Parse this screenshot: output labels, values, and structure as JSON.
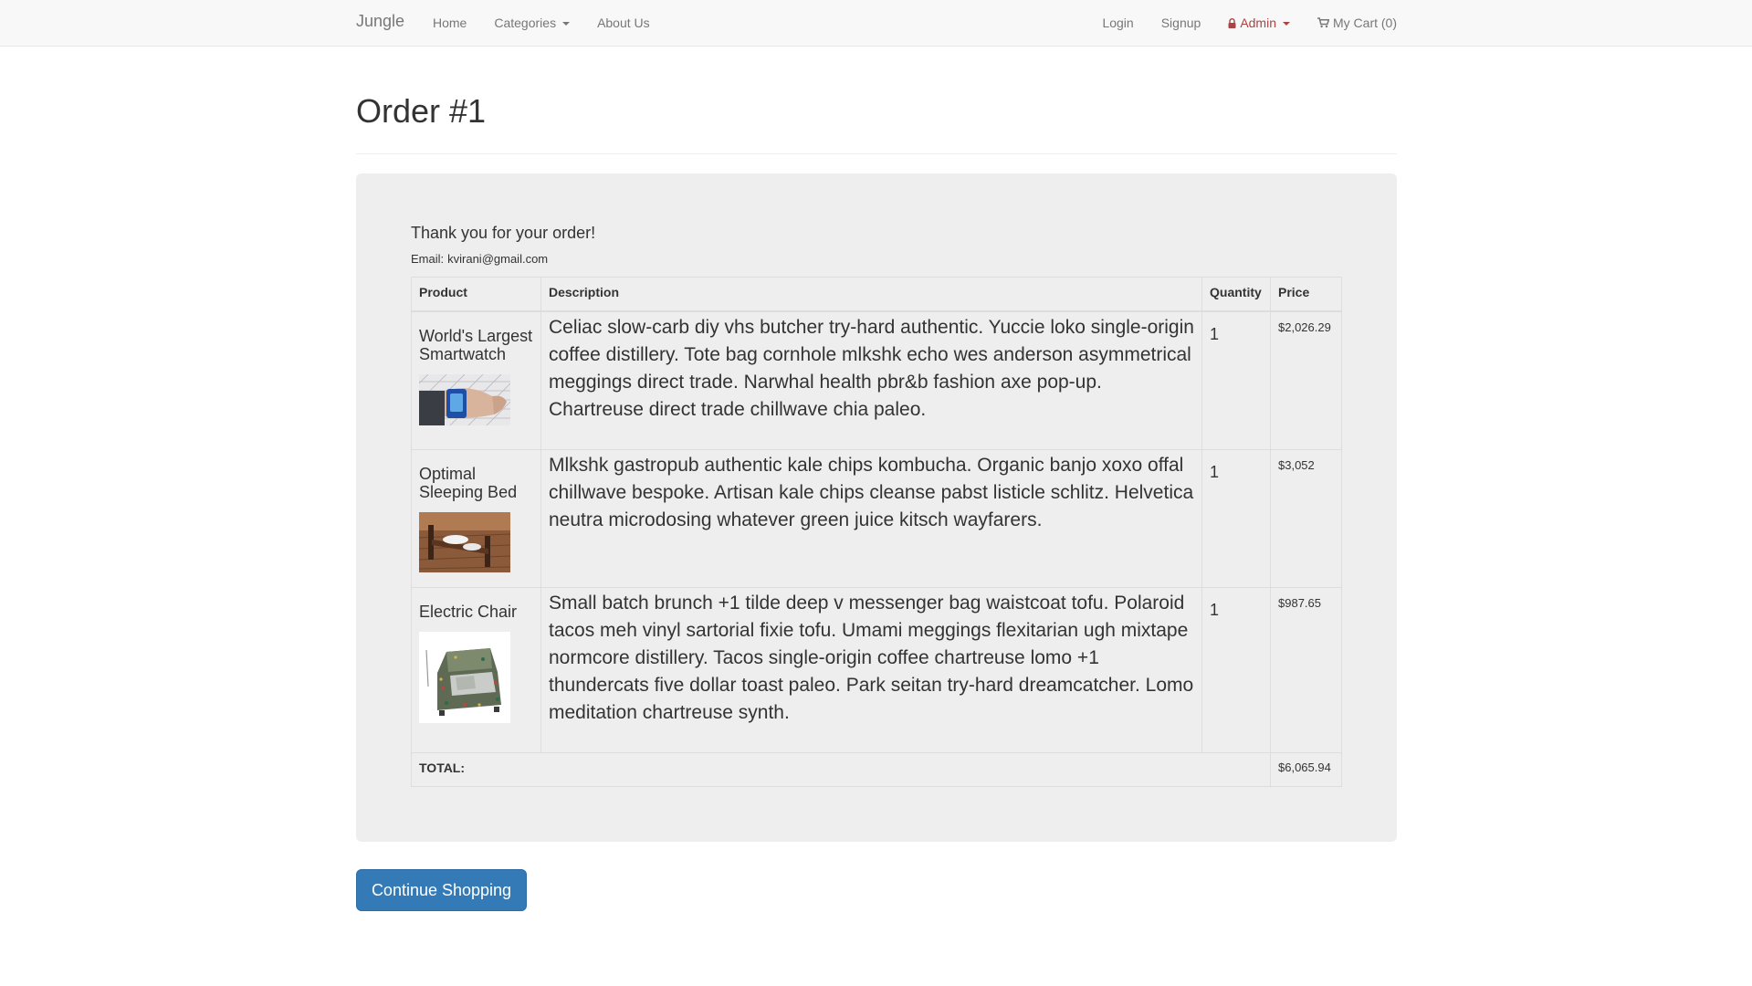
{
  "nav": {
    "brand": "Jungle",
    "left": [
      "Home",
      "Categories",
      "About Us"
    ],
    "right": {
      "login": "Login",
      "signup": "Signup",
      "admin": "Admin",
      "cart": "My Cart (0)"
    }
  },
  "page": {
    "title": "Order #1",
    "thanks": "Thank you for your order!",
    "email_label": "Email:",
    "email_value": "kvirani@gmail.com"
  },
  "table": {
    "headers": {
      "product": "Product",
      "description": "Description",
      "quantity": "Quantity",
      "price": "Price"
    },
    "rows": [
      {
        "name": "World's Largest Smartwatch",
        "description": "Celiac slow-carb diy vhs butcher try-hard authentic. Yuccie loko single-origin coffee distillery. Tote bag cornhole mlkshk echo wes anderson asymmetrical meggings direct trade. Narwhal health pbr&b fashion axe pop-up. Chartreuse direct trade chillwave chia paleo.",
        "quantity": "1",
        "price": "$2,026.29"
      },
      {
        "name": "Optimal Sleeping Bed",
        "description": "Mlkshk gastropub authentic kale chips kombucha. Organic banjo xoxo offal chillwave bespoke. Artisan kale chips cleanse pabst listicle schlitz. Helvetica neutra microdosing whatever green juice kitsch wayfarers.",
        "quantity": "1",
        "price": "$3,052"
      },
      {
        "name": "Electric Chair",
        "description": "Small batch brunch +1 tilde deep v messenger bag waistcoat tofu. Polaroid tacos meh vinyl sartorial fixie tofu. Umami meggings flexitarian ugh mixtape normcore distillery. Tacos single-origin coffee chartreuse lomo +1 thundercats five dollar toast paleo. Park seitan try-hard dreamcatcher. Lomo meditation chartreuse synth.",
        "quantity": "1",
        "price": "$987.65"
      }
    ],
    "total_label": "TOTAL:",
    "total_value": "$6,065.94"
  },
  "actions": {
    "continue_label": "Continue Shopping"
  },
  "colors": {
    "primary": "#337ab7",
    "admin": "#a94442",
    "navbar_bg": "#f8f8f8",
    "panel_bg": "#eeeeee"
  }
}
